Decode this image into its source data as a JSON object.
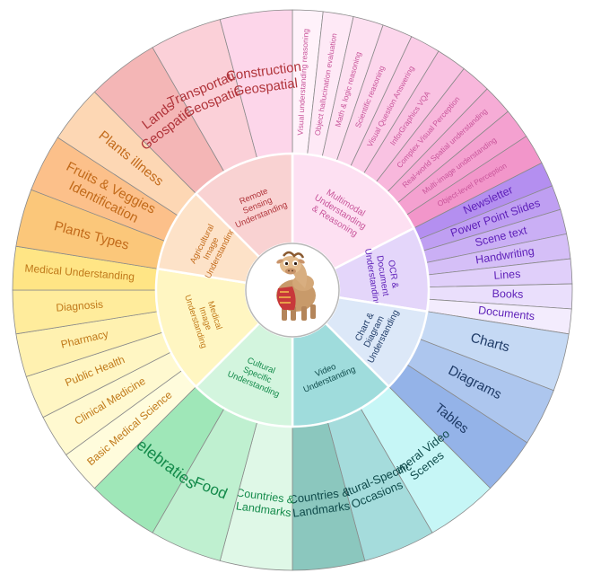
{
  "center_icon": "camel-mascot-icon",
  "categories": [
    {
      "key": "multimodal",
      "label": [
        "Multimodal",
        "Understanding",
        "& Reasoning"
      ],
      "inner_color": "#fde0f2",
      "text_color": "#c8559a",
      "items": [
        {
          "lines": [
            "Visual understanding reasoning"
          ],
          "color": "#fff2fa"
        },
        {
          "lines": [
            "Object hallucination evaluation"
          ],
          "color": "#fee9f6"
        },
        {
          "lines": [
            "Math & logic reasoning"
          ],
          "color": "#fde0f1"
        },
        {
          "lines": [
            "Scientific reasoning"
          ],
          "color": "#fcd6ec"
        },
        {
          "lines": [
            "Visual Question Answering"
          ],
          "color": "#fbcce7"
        },
        {
          "lines": [
            "InforGraphics VQA"
          ],
          "color": "#f9c2e2"
        },
        {
          "lines": [
            "Complex Visual Perception"
          ],
          "color": "#f8b7dc"
        },
        {
          "lines": [
            "Real-world Spatial understanding"
          ],
          "color": "#f6acd6"
        },
        {
          "lines": [
            "Multi-image understanding"
          ],
          "color": "#f4a1d0"
        },
        {
          "lines": [
            "Object-level Perception"
          ],
          "color": "#f296ca"
        }
      ]
    },
    {
      "key": "ocr",
      "label": [
        "OCR &",
        "Document",
        "Understanding"
      ],
      "inner_color": "#e4d6fa",
      "text_color": "#5d1fb8",
      "items": [
        {
          "lines": [
            "Newsletter"
          ],
          "color": "#b48ff0"
        },
        {
          "lines": [
            "Power Point Slides"
          ],
          "color": "#bf9ff2"
        },
        {
          "lines": [
            "Scene text"
          ],
          "color": "#caaff5"
        },
        {
          "lines": [
            "Handwriting"
          ],
          "color": "#d5bff7"
        },
        {
          "lines": [
            "Lines"
          ],
          "color": "#e0cffa"
        },
        {
          "lines": [
            "Books"
          ],
          "color": "#eadffc"
        },
        {
          "lines": [
            "Documents"
          ],
          "color": "#f3ecfd"
        }
      ]
    },
    {
      "key": "chart",
      "label": [
        "Chart &",
        "Diagram",
        "Understanding"
      ],
      "inner_color": "#dce8f8",
      "text_color": "#1e3a66",
      "items": [
        {
          "lines": [
            "Charts"
          ],
          "color": "#c5d9f4"
        },
        {
          "lines": [
            "Diagrams"
          ],
          "color": "#adc6ee"
        },
        {
          "lines": [
            "Tables"
          ],
          "color": "#94b3e8"
        }
      ]
    },
    {
      "key": "video",
      "label": [
        "Video",
        "Understanding"
      ],
      "inner_color": "#9fdcdc",
      "text_color": "#0e4a4a",
      "items": [
        {
          "lines": [
            "General Video",
            "Scenes"
          ],
          "color": "#c6f6f6"
        },
        {
          "lines": [
            "Cultural-Specific",
            "Occasions"
          ],
          "color": "#a5dcdc"
        },
        {
          "lines": [
            "Countries &",
            "Landmarks"
          ],
          "color": "#8bc7be"
        }
      ]
    },
    {
      "key": "cultural",
      "label": [
        "Cultural",
        "Specific",
        "Understanding"
      ],
      "inner_color": "#d3f5de",
      "text_color": "#138a4a",
      "items": [
        {
          "lines": [
            "Countries &",
            "Landmarks"
          ],
          "color": "#dff8e7"
        },
        {
          "lines": [
            "Food"
          ],
          "color": "#bff0d0"
        },
        {
          "lines": [
            "Celebraties"
          ],
          "color": "#9fe7b8"
        }
      ]
    },
    {
      "key": "medical",
      "label": [
        "Medical",
        "Image",
        "Understanding"
      ],
      "inner_color": "#fff6c2",
      "text_color": "#c0791a",
      "items": [
        {
          "lines": [
            "Basic Medical Science"
          ],
          "color": "#fffcdc"
        },
        {
          "lines": [
            "Clinical Medicine"
          ],
          "color": "#fff9d0"
        },
        {
          "lines": [
            "Public Health"
          ],
          "color": "#fff6c3"
        },
        {
          "lines": [
            "Pharmacy"
          ],
          "color": "#fff1b0"
        },
        {
          "lines": [
            "Diagnosis"
          ],
          "color": "#ffec9c"
        },
        {
          "lines": [
            "Medical Understanding"
          ],
          "color": "#ffe585"
        }
      ]
    },
    {
      "key": "agricultural",
      "label": [
        "Agricultural",
        "Image",
        "Understanding"
      ],
      "inner_color": "#fde2c8",
      "text_color": "#c26a1a",
      "items": [
        {
          "lines": [
            "Plants Types"
          ],
          "color": "#fbc77a"
        },
        {
          "lines": [
            "Fruits & Veggies",
            "Identification"
          ],
          "color": "#fcc08a"
        },
        {
          "lines": [
            "Plants illness"
          ],
          "color": "#fdd7b4"
        }
      ]
    },
    {
      "key": "remote",
      "label": [
        "Remote",
        "Sensing",
        "Understanding"
      ],
      "inner_color": "#f9d2d2",
      "text_color": "#b0343a",
      "items": [
        {
          "lines": [
            "Lands",
            "Geospatial"
          ],
          "color": "#f4b6b6"
        },
        {
          "lines": [
            "Transportation",
            "Geospatial"
          ],
          "color": "#fbd0d8"
        },
        {
          "lines": [
            "Construction",
            "Geospatial"
          ],
          "color": "#fdd6ea"
        }
      ]
    }
  ]
}
